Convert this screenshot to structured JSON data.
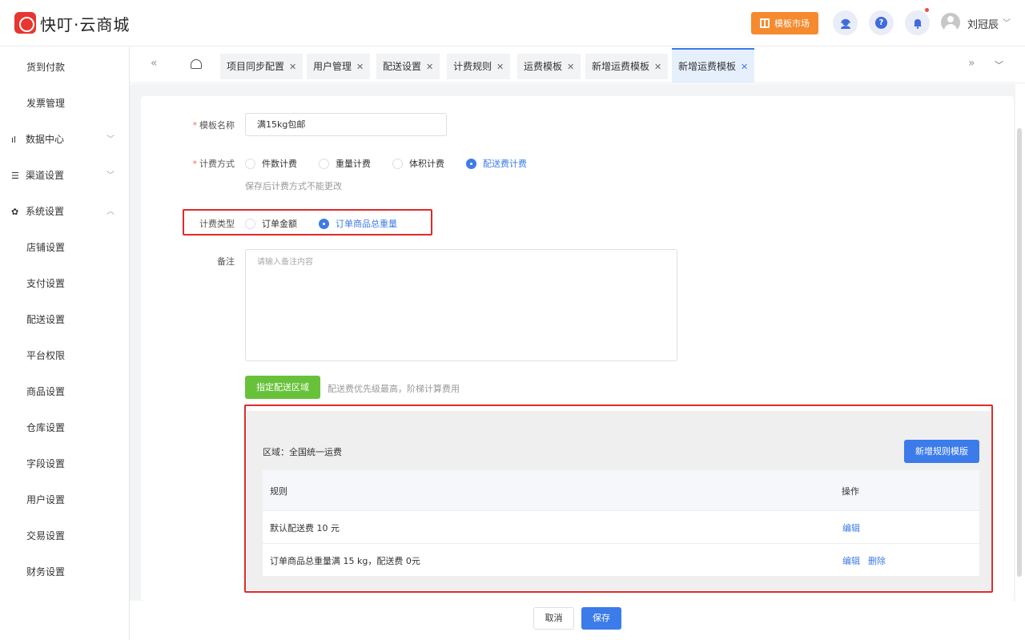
{
  "header": {
    "brand": "快叮·云商城",
    "market_label": "模板市场",
    "help_glyph": "?",
    "user_name": "刘冠辰"
  },
  "sidebar": {
    "items": [
      {
        "label": "货到付款",
        "kind": "sub"
      },
      {
        "label": "发票管理",
        "kind": "sub"
      },
      {
        "label": "数据中心",
        "kind": "group",
        "icon": "bar-chart-icon",
        "expanded": false
      },
      {
        "label": "渠道设置",
        "kind": "group",
        "icon": "list-icon",
        "expanded": false
      },
      {
        "label": "系统设置",
        "kind": "group",
        "icon": "gear-icon",
        "expanded": true
      },
      {
        "label": "店铺设置",
        "kind": "sub"
      },
      {
        "label": "支付设置",
        "kind": "sub"
      },
      {
        "label": "配送设置",
        "kind": "sub"
      },
      {
        "label": "平台权限",
        "kind": "sub"
      },
      {
        "label": "商品设置",
        "kind": "sub"
      },
      {
        "label": "仓库设置",
        "kind": "sub"
      },
      {
        "label": "字段设置",
        "kind": "sub"
      },
      {
        "label": "用户设置",
        "kind": "sub"
      },
      {
        "label": "交易设置",
        "kind": "sub"
      },
      {
        "label": "财务设置",
        "kind": "sub"
      }
    ]
  },
  "tabs": [
    {
      "label": "项目同步配置"
    },
    {
      "label": "用户管理"
    },
    {
      "label": "配送设置"
    },
    {
      "label": "计费规则"
    },
    {
      "label": "运费模板"
    },
    {
      "label": "新增运费模板"
    },
    {
      "label": "新增运费模板",
      "active": true
    }
  ],
  "form": {
    "template_name_label": "模板名称",
    "template_name_value": "满15kg包邮",
    "billing_method_label": "计费方式",
    "billing_methods": [
      "件数计费",
      "重量计费",
      "体积计费",
      "配送费计费"
    ],
    "billing_method_selected": "配送费计费",
    "billing_method_hint": "保存后计费方式不能更改",
    "billing_type_label": "计费类型",
    "billing_types": [
      "订单金额",
      "订单商品总重量"
    ],
    "billing_type_selected": "订单商品总重量",
    "remark_label": "备注",
    "remark_placeholder": "请输入备注内容",
    "assign_area_button": "指定配送区域",
    "assign_area_hint": "配送费优先级最高，阶梯计算费用"
  },
  "zone": {
    "title": "区域：全国统一运费",
    "add_rule_button": "新增规则模版",
    "columns": [
      "规则",
      "操作"
    ],
    "rows": [
      {
        "rule": "默认配送费 10 元",
        "actions": [
          "编辑"
        ]
      },
      {
        "rule": "订单商品总重量满 15 kg，配送费 0元",
        "actions": [
          "编辑",
          "删除"
        ]
      }
    ]
  },
  "footer": {
    "cancel": "取消",
    "save": "保存"
  },
  "colors": {
    "accent": "#3c7bea",
    "market": "#f58a2e",
    "assign_button": "#67c23a",
    "highlight_box": "#e02a2a"
  }
}
